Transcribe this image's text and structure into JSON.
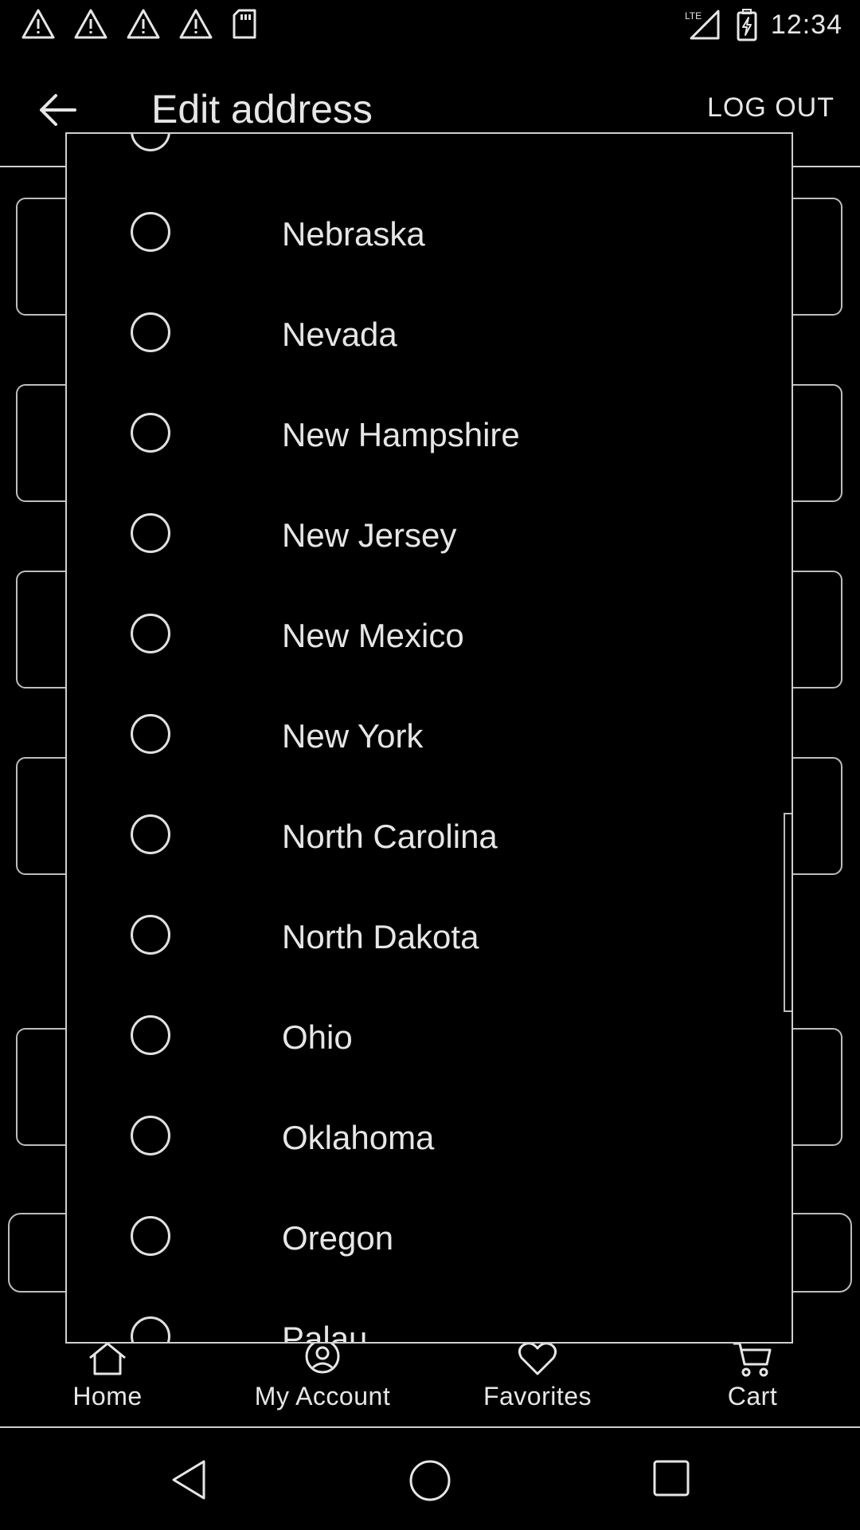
{
  "status_bar": {
    "time": "12:34",
    "network": "LTE",
    "left_icons": [
      "warning-icon",
      "warning-icon",
      "warning-icon",
      "warning-icon",
      "sd-card-icon"
    ]
  },
  "app_bar": {
    "title": "Edit address",
    "logout_label": "LOG OUT"
  },
  "dialog": {
    "options": [
      {
        "label": ""
      },
      {
        "label": "Nebraska"
      },
      {
        "label": "Nevada"
      },
      {
        "label": "New Hampshire"
      },
      {
        "label": "New Jersey"
      },
      {
        "label": "New Mexico"
      },
      {
        "label": "New York"
      },
      {
        "label": "North Carolina"
      },
      {
        "label": "North Dakota"
      },
      {
        "label": "Ohio"
      },
      {
        "label": "Oklahoma"
      },
      {
        "label": "Oregon"
      },
      {
        "label": "Palau"
      }
    ]
  },
  "bottom_nav": {
    "items": [
      {
        "label": "Home",
        "icon": "home-icon"
      },
      {
        "label": "My Account",
        "icon": "account-icon"
      },
      {
        "label": "Favorites",
        "icon": "heart-icon"
      },
      {
        "label": "Cart",
        "icon": "cart-icon"
      }
    ]
  }
}
